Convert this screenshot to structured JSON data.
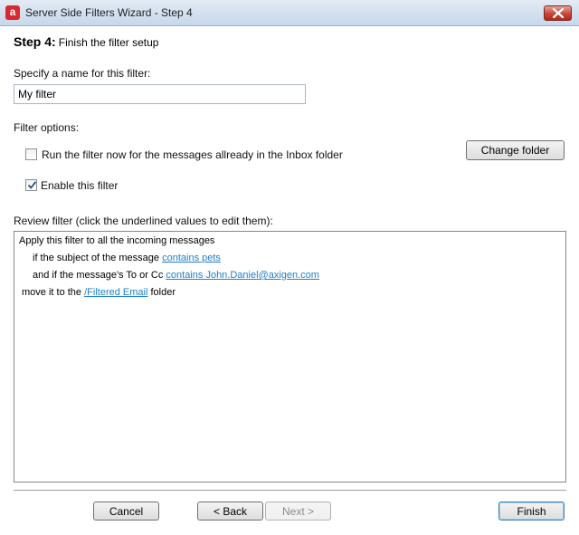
{
  "window": {
    "title": "Server Side Filters Wizard - Step 4",
    "icon_letter": "a"
  },
  "step": {
    "label": "Step 4:",
    "description": "Finish the filter setup"
  },
  "name_field": {
    "label": "Specify a name for this filter:",
    "value": "My filter"
  },
  "options": {
    "label": "Filter options:",
    "run_now": {
      "label": "Run the filter now for the messages allready in the Inbox folder",
      "checked": false
    },
    "enable": {
      "label": "Enable this filter",
      "checked": true
    },
    "change_folder_label": "Change folder"
  },
  "review": {
    "label": "Review filter (click the underlined values to edit them):",
    "line1": "Apply this filter to all the incoming messages",
    "line2_prefix": "if the subject of the message",
    "line2_link": "contains pets",
    "line3_prefix": "and if the message's To or Cc",
    "line3_link": "contains John.Daniel@axigen.com",
    "line4_prefix": "move it to the",
    "line4_link": "/Filtered Email",
    "line4_suffix": "folder"
  },
  "buttons": {
    "cancel": "Cancel",
    "back": "< Back",
    "next": "Next >",
    "finish": "Finish"
  }
}
